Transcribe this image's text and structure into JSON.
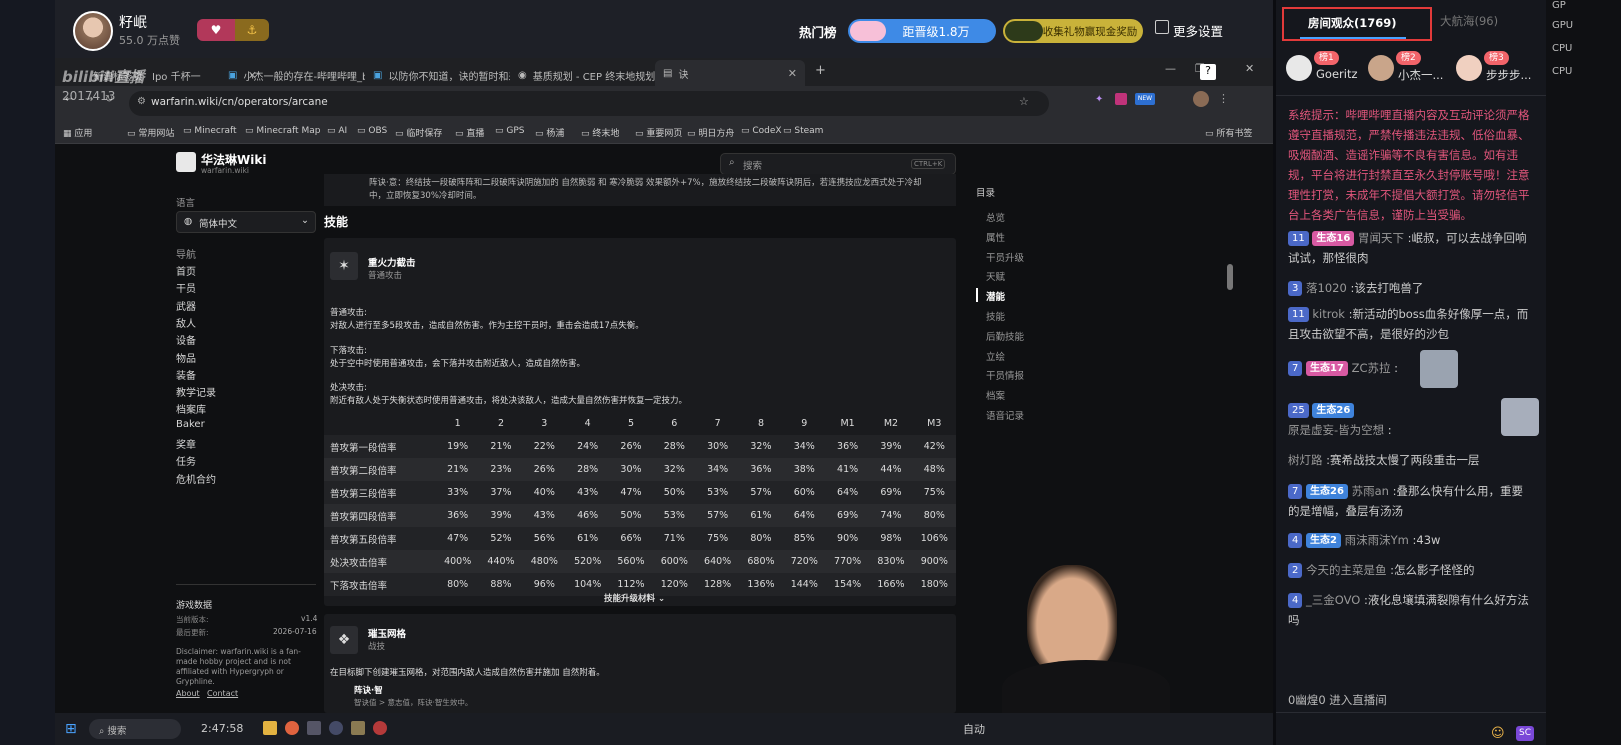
{
  "streamer": {
    "name": "籽岷",
    "likes": "55.0 万点赞"
  },
  "top_right": {
    "hot_rank": "热门榜",
    "promotion": "距晋级1.8万",
    "gift_text": "收集礼物赢现金奖励",
    "settings": "更多设置"
  },
  "logo": "bilibili直播",
  "logo_id": "2017413",
  "browser": {
    "tabs": [
      "新建标签页",
      "Ipo 千杯一",
      "小杰一般的存在-哔哩哔哩_bili",
      "以防你不知道，诀的暂时和差",
      "基质规划 - CEP 终末地规划器",
      "诀"
    ],
    "url": "warfarin.wiki/cn/operators/arcane",
    "bookmarks": [
      "应用",
      "常用网站",
      "Minecraft",
      "Minecraft Map",
      "AI",
      "OBS",
      "临时保存",
      "直播",
      "GPS",
      "杨浦",
      "终末地",
      "重要网页",
      "明日方舟",
      "CodeX",
      "Steam",
      "所有书签"
    ]
  },
  "wiki": {
    "site_name": "华法琳Wiki",
    "site_domain": "warfarin.wiki",
    "search_placeholder": "搜索",
    "search_shortcut": "CTRL+K",
    "lang_label": "语言",
    "lang_value": "简体中文",
    "nav_title": "导航",
    "nav": [
      "首页",
      "干员",
      "武器",
      "敌人",
      "设备",
      "物品",
      "装备",
      "教学记录",
      "档案库",
      "Baker",
      "奖章",
      "任务",
      "危机合约"
    ],
    "data_title": "游戏数据",
    "version_label": "当前版本:",
    "version": "v1.4",
    "updated_label": "最后更新:",
    "updated": "2026-07-16",
    "disclaimer": "Disclaimer: warfarin.wiki is a fan-made hobby project and is not affiliated with Hypergryph or Gryphline.",
    "about": "About",
    "contact": "Contact",
    "toc_title": "目录",
    "toc": [
      "总览",
      "属性",
      "干员升级",
      "天赋",
      "潜能",
      "技能",
      "后勤技能",
      "立绘",
      "干员情报",
      "档案",
      "语音记录"
    ],
    "top_text1": "阵诀·意：终结技一段破阵阵和二段破阵诀阴施加的 自然脆弱 和 寒冷脆弱 效果额外+7%，施放终结技二段破阵诀阴后，若连携技应龙西式处于冷却",
    "top_text2": "中，立即恢复30%冷却时间。",
    "section": "技能",
    "skill1": {
      "name": "重火力截击",
      "type": "普通攻击"
    },
    "p1h": "普通攻击:",
    "p1": "对敌人进行至多5段攻击，造成自然伤害。作为主控干员时，重击会造成17点失衡。",
    "p2h": "下落攻击:",
    "p2": "处于空中时使用普通攻击，会下落并攻击附近敌人，造成自然伤害。",
    "p3h": "处决攻击:",
    "p3": "附近有敌人处于失衡状态时使用普通攻击，将处决该敌人，造成大量自然伤害并恢复一定技力。",
    "table": {
      "headers": [
        "1",
        "2",
        "3",
        "4",
        "5",
        "6",
        "7",
        "8",
        "9",
        "M1",
        "M2",
        "M3"
      ],
      "rows": [
        {
          "label": "普攻第一段倍率",
          "v": [
            "19%",
            "21%",
            "22%",
            "24%",
            "26%",
            "28%",
            "30%",
            "32%",
            "34%",
            "36%",
            "39%",
            "42%"
          ]
        },
        {
          "label": "普攻第二段倍率",
          "v": [
            "21%",
            "23%",
            "26%",
            "28%",
            "30%",
            "32%",
            "34%",
            "36%",
            "38%",
            "41%",
            "44%",
            "48%"
          ]
        },
        {
          "label": "普攻第三段倍率",
          "v": [
            "33%",
            "37%",
            "40%",
            "43%",
            "47%",
            "50%",
            "53%",
            "57%",
            "60%",
            "64%",
            "69%",
            "75%"
          ]
        },
        {
          "label": "普攻第四段倍率",
          "v": [
            "36%",
            "39%",
            "43%",
            "46%",
            "50%",
            "53%",
            "57%",
            "61%",
            "64%",
            "69%",
            "74%",
            "80%"
          ]
        },
        {
          "label": "普攻第五段倍率",
          "v": [
            "47%",
            "52%",
            "56%",
            "61%",
            "66%",
            "71%",
            "75%",
            "80%",
            "85%",
            "90%",
            "98%",
            "106%"
          ]
        },
        {
          "label": "处决攻击倍率",
          "v": [
            "400%",
            "440%",
            "480%",
            "520%",
            "560%",
            "600%",
            "640%",
            "680%",
            "720%",
            "770%",
            "830%",
            "900%"
          ]
        },
        {
          "label": "下落攻击倍率",
          "v": [
            "80%",
            "88%",
            "96%",
            "104%",
            "112%",
            "120%",
            "128%",
            "136%",
            "144%",
            "154%",
            "166%",
            "180%"
          ]
        }
      ]
    },
    "upgrade_mat": "技能升级材料",
    "skill2": {
      "name": "璀玉网格",
      "type": "战技"
    },
    "s2text": "在目标脚下创建璀玉网格，对范围内敌人造成自然伤害并施加 自然附着。",
    "s2sub": "阵诀·智",
    "s2sub2": "智诀值 > 意志值，阵诀·智生效中。"
  },
  "taskbar": {
    "search": "搜索",
    "time_left": "2:47:58",
    "auto": "自动"
  },
  "panel": {
    "tab_active": "房间观众(1769)",
    "tab_inactive": "大航海(96)",
    "ranks": [
      {
        "badge": "榜1",
        "name": "Goeritz"
      },
      {
        "badge": "榜2",
        "name": "小杰一..."
      },
      {
        "badge": "榜3",
        "name": "步步步..."
      }
    ],
    "system": "系统提示：哔哩哔哩直播内容及互动评论须严格遵守直播规范，严禁传播违法违规、低俗血暴、吸烟酗酒、造谣诈骗等不良有害信息。如有违规，平台将进行封禁直至永久封停账号哦！注意理性打赏，未成年不提倡大额打赏。请勿轻信平台上各类广告信息，谨防上当受骗。",
    "msgs": [
      {
        "lv": "11",
        "tag": "生态16",
        "user": "胃闻天下",
        "text": "岷叔，可以去战争回响试试，那怪很肉"
      },
      {
        "lv": "3",
        "tag": "",
        "user": "落1020",
        "text": "该去打咆兽了"
      },
      {
        "lv": "11",
        "tag": "",
        "user": "kitrok",
        "text": "新活动的boss血条好像厚一点，而且攻击欲望不高，是很好的沙包"
      },
      {
        "lv": "7",
        "tag": "生态17",
        "user": "ZC苏拉",
        "text": ""
      },
      {
        "lv": "25",
        "tag": "生态26",
        "user": "原是虚妄-皆为空想",
        "text": ""
      },
      {
        "lv": "",
        "tag": "",
        "user": "树灯路",
        "text": "赛希战技太慢了两段重击一层"
      },
      {
        "lv": "7",
        "tag": "生态26",
        "user": "苏雨an",
        "text": "叠那么快有什么用，重要的是增幅，叠层有汤汤"
      },
      {
        "lv": "4",
        "tag": "生态2",
        "user": "雨沫雨沫Ym",
        "text": "43w"
      },
      {
        "lv": "2",
        "tag": "",
        "user": "今天的主菜是鱼",
        "text": "怎么影子怪怪的"
      },
      {
        "lv": "4",
        "tag": "",
        "user": "_三金OVO",
        "text": "液化息壤填满裂隙有什么好方法吗"
      }
    ],
    "enter": "0幽煌0 进入直播间"
  },
  "far_right": [
    "GP",
    "GPU",
    "CPU",
    "CPU"
  ]
}
